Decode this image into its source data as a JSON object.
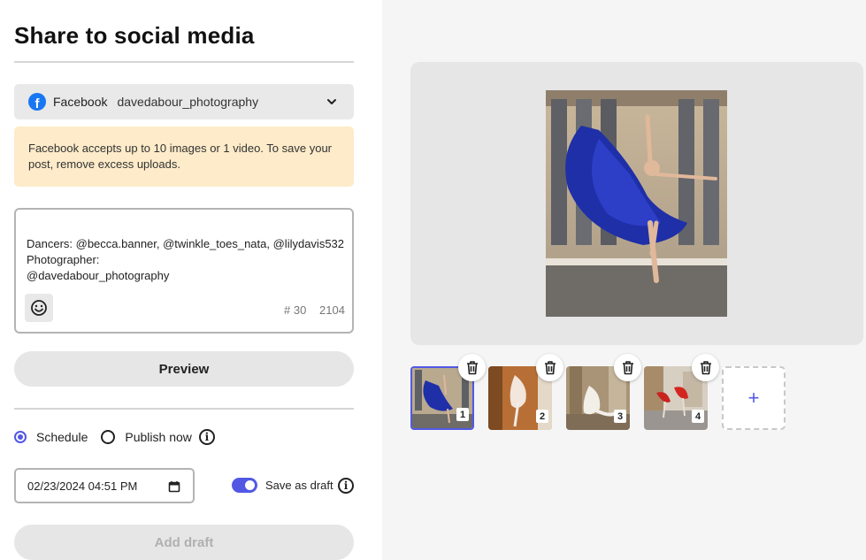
{
  "title": "Share to social media",
  "account": {
    "platform": "Facebook",
    "username": "davedabour_photography",
    "icon": "facebook-icon"
  },
  "warning": {
    "text": "Facebook accepts up to 10 images or 1 video. To save your post, remove excess uploads."
  },
  "caption": {
    "text": "Dancers: @becca.banner, @twinkle_toes_nata, @lilydavis532\nPhotographer:\n@davedabour_photography",
    "hashtag_count": "# 30",
    "char_count": "2104"
  },
  "preview_label": "Preview",
  "schedule": {
    "schedule_label": "Schedule",
    "publish_now_label": "Publish now",
    "selected": "Schedule"
  },
  "datetime": {
    "value": "02/23/2024 04:51 PM"
  },
  "save_as_draft": {
    "label": "Save as draft",
    "on": true
  },
  "add_draft_label": "Add draft",
  "thumbnails": [
    {
      "number": "1",
      "selected": true
    },
    {
      "number": "2",
      "selected": false
    },
    {
      "number": "3",
      "selected": false
    },
    {
      "number": "4",
      "selected": false
    }
  ],
  "add_tile_label": "+",
  "colors": {
    "accent": "#5258e4",
    "facebook": "#1877f2",
    "warning_bg": "#fdebc9"
  }
}
